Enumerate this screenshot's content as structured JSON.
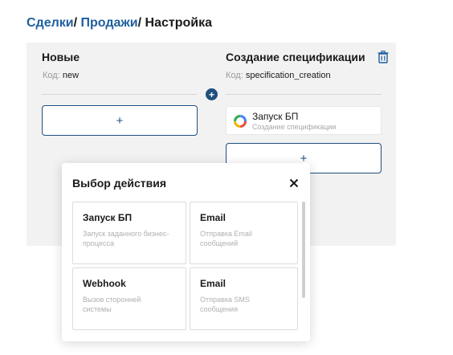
{
  "breadcrumb": {
    "items": [
      "Сделки",
      "Продажи"
    ],
    "separator": "/",
    "current": "Настройка"
  },
  "columns": [
    {
      "title": "Новые",
      "code_label": "Код:",
      "code_value": "new",
      "add_label": "+"
    },
    {
      "title": "Создание спецификации",
      "code_label": "Код:",
      "code_value": "specification_creation",
      "add_label": "+",
      "action": {
        "title": "Запуск БП",
        "subtitle": "Создание спецификации",
        "icon": "process-loader-icon"
      }
    }
  ],
  "connector": {
    "label": "+"
  },
  "modal": {
    "title": "Выбор действия",
    "close_icon": "close-icon",
    "options": [
      {
        "title": "Запуск БП",
        "description": "Запуск заданного бизнес-процесса"
      },
      {
        "title": "Email",
        "description": "Отправка Email сообщений"
      },
      {
        "title": "Webhook",
        "description": "Вызов сторонней системы"
      },
      {
        "title": "Email",
        "description": "Отправка SMS сообщения"
      }
    ]
  },
  "colors": {
    "link": "#1f5f9e",
    "accent": "#1f4f7f",
    "board_bg": "#f2f2f2",
    "muted_text": "#9a9a9a"
  }
}
